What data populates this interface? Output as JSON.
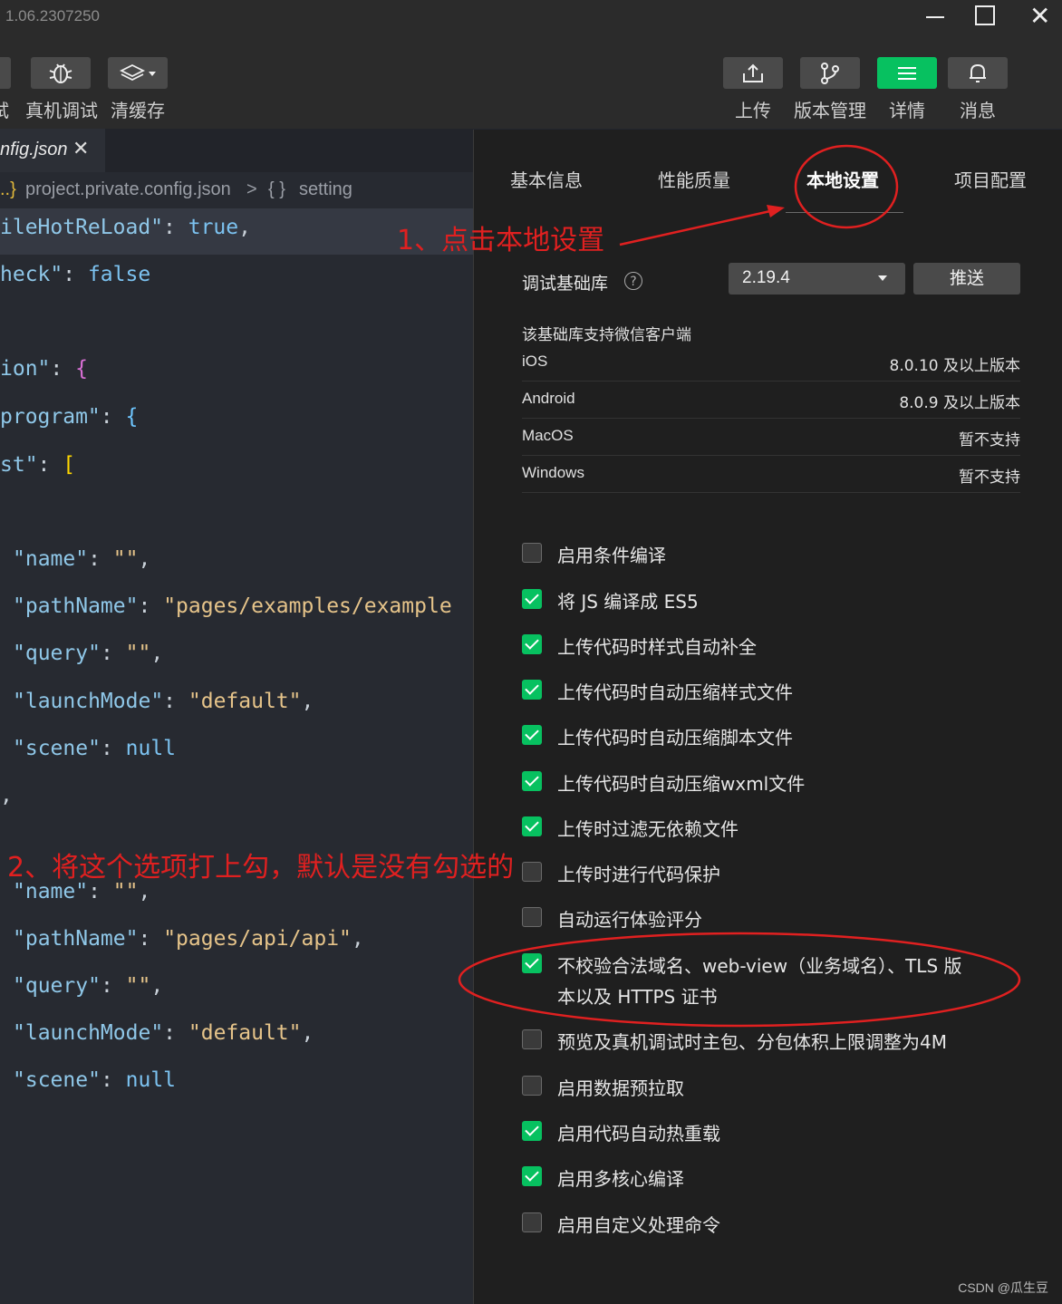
{
  "window": {
    "version": "1.06.2307250",
    "controls": {
      "minimize": "minimize-icon",
      "maximize": "maximize-icon",
      "close": "✕"
    }
  },
  "toolbar": {
    "left": [
      {
        "label": "真机调试",
        "icon": "bug-icon"
      },
      {
        "label": "清缓存",
        "icon": "layers-icon"
      }
    ],
    "right": [
      {
        "label": "上传",
        "icon": "upload-icon"
      },
      {
        "label": "版本管理",
        "icon": "branch-icon"
      },
      {
        "label": "详情",
        "icon": "menu-icon",
        "active_color": "#07c160"
      },
      {
        "label": "消息",
        "icon": "bell-icon"
      }
    ],
    "partial_left_label": "试"
  },
  "editor": {
    "tab": {
      "name": "nfig.json",
      "close": "✕"
    },
    "breadcrumb": {
      "prefix": "..}",
      "file": "project.private.config.json",
      "sep": ">",
      "obj": "{ }",
      "node": "setting"
    },
    "lines": [
      {
        "key": "ileHotReLoad",
        "after": ": ",
        "val": "true",
        "tail": ","
      },
      {
        "key": "heck",
        "after": ": ",
        "val": "false",
        "tail": ""
      },
      {
        "key": "ion",
        "after": ": ",
        "val": "{",
        "tail": ""
      },
      {
        "key": "program",
        "after": ": ",
        "val": "{",
        "tail": ""
      },
      {
        "key": "st",
        "after": ": ",
        "val": "[",
        "tail": ""
      },
      {
        "key": "name",
        "after": ": ",
        "val": "\"\"",
        "tail": ","
      },
      {
        "key": "pathName",
        "after": ": ",
        "val": "\"pages/examples/example",
        "tail": ""
      },
      {
        "key": "query",
        "after": ": ",
        "val": "\"\"",
        "tail": ","
      },
      {
        "key": "launchMode",
        "after": ": ",
        "val": "\"default\"",
        "tail": ","
      },
      {
        "key": "scene",
        "after": ": ",
        "val": "null",
        "tail": ""
      },
      {
        "text": ","
      },
      {
        "key": "name",
        "after": ": ",
        "val": "\"\"",
        "tail": ","
      },
      {
        "key": "pathName",
        "after": ": ",
        "val": "\"pages/api/api\"",
        "tail": ","
      },
      {
        "key": "query",
        "after": ": ",
        "val": "\"\"",
        "tail": ","
      },
      {
        "key": "launchMode",
        "after": ": ",
        "val": "\"default\"",
        "tail": ","
      },
      {
        "key": "scene",
        "after": ": ",
        "val": "null",
        "tail": ""
      }
    ]
  },
  "panel": {
    "tabs": [
      "基本信息",
      "性能质量",
      "本地设置",
      "项目配置"
    ],
    "active_tab": "本地设置",
    "lib": {
      "label": "调试基础库",
      "help": "?",
      "version": "2.19.4",
      "push": "推送"
    },
    "support": {
      "title": "该基础库支持微信客户端",
      "rows": [
        {
          "name": "iOS",
          "value": "8.0.10 及以上版本"
        },
        {
          "name": "Android",
          "value": "8.0.9 及以上版本"
        },
        {
          "name": "MacOS",
          "value": "暂不支持"
        },
        {
          "name": "Windows",
          "value": "暂不支持"
        }
      ]
    },
    "options": [
      {
        "label": "启用条件编译",
        "checked": false
      },
      {
        "label": "将 JS 编译成 ES5",
        "checked": true
      },
      {
        "label": "上传代码时样式自动补全",
        "checked": true
      },
      {
        "label": "上传代码时自动压缩样式文件",
        "checked": true
      },
      {
        "label": "上传代码时自动压缩脚本文件",
        "checked": true
      },
      {
        "label": "上传代码时自动压缩wxml文件",
        "checked": true
      },
      {
        "label": "上传时过滤无依赖文件",
        "checked": true
      },
      {
        "label": "上传时进行代码保护",
        "checked": false
      },
      {
        "label": "自动运行体验评分",
        "checked": false
      },
      {
        "label": "不校验合法域名、web-view（业务域名）、TLS 版",
        "label2": "本以及 HTTPS 证书",
        "checked": true
      },
      {
        "label": "预览及真机调试时主包、分包体积上限调整为4M",
        "checked": false
      },
      {
        "label": "启用数据预拉取",
        "checked": false
      },
      {
        "label": "启用代码自动热重载",
        "checked": true
      },
      {
        "label": "启用多核心编译",
        "checked": true
      },
      {
        "label": "启用自定义处理命令",
        "checked": false
      }
    ],
    "watermark": "CSDN @瓜生豆"
  },
  "annotations": {
    "step1": "1、点击本地设置",
    "step2": "2、将这个选项打上勾，默认是没有勾选的",
    "color": "#e02020"
  }
}
